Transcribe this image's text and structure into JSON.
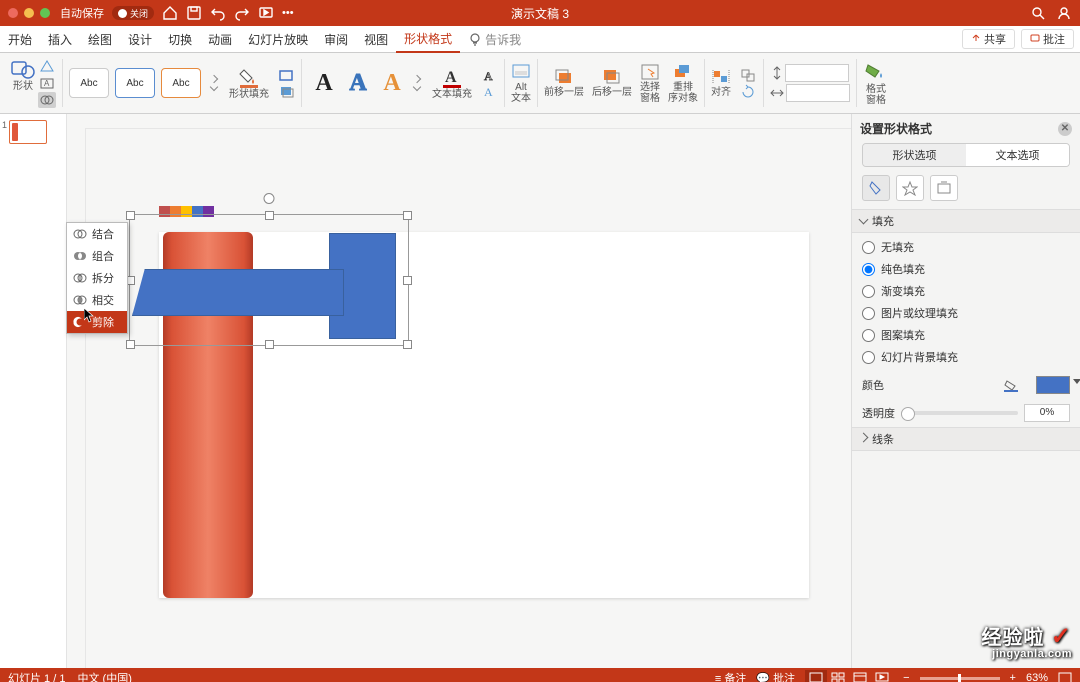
{
  "titlebar": {
    "traffic": [
      "#ed6a5e",
      "#f5bf4f",
      "#61c554"
    ],
    "autosave_label": "自动保存",
    "autosave_state": "关闭",
    "title": "演示文稿 3"
  },
  "menubar": {
    "tabs": [
      "开始",
      "插入",
      "绘图",
      "设计",
      "切换",
      "动画",
      "幻灯片放映",
      "审阅",
      "视图",
      "形状格式"
    ],
    "active": 9,
    "tellme": "告诉我",
    "share": "共享",
    "comments": "批注"
  },
  "ribbon": {
    "shape_lbl": "形状",
    "abc_cards": [
      "Abc",
      "Abc",
      "Abc"
    ],
    "shape_fill_lbl": "形状填充",
    "text_fill_lbl": "文本填充",
    "alt_lbl": "Alt\n文本",
    "bring_fwd": "前移一层",
    "send_back": "后移一层",
    "sel_pane": "选择\n窗格",
    "arrange": "重排\n序对象",
    "align_lbl": "对齐",
    "size_w": "",
    "size_h": "",
    "fmt_pane_lbl": "格式\n窗格"
  },
  "merge_menu": {
    "items": [
      "结合",
      "组合",
      "拆分",
      "相交",
      "剪除"
    ],
    "hover": 4
  },
  "thumbs": {
    "n1": "1"
  },
  "slide_colors": [
    "#c0504d",
    "#ed7d31",
    "#a5a5a5",
    "#ffc000",
    "#5b9bd5",
    "#7030a0"
  ],
  "fmt_pane": {
    "title": "设置形状格式",
    "tab_shape": "形状选项",
    "tab_text": "文本选项",
    "sect_fill": "填充",
    "fills": [
      "无填充",
      "纯色填充",
      "渐变填充",
      "图片或纹理填充",
      "图案填充",
      "幻灯片背景填充"
    ],
    "fill_sel": 1,
    "color_lbl": "颜色",
    "opacity_lbl": "透明度",
    "opacity_val": "0%",
    "sect_line": "线条"
  },
  "status": {
    "slide": "幻灯片 1 / 1",
    "lang": "中文 (中国)",
    "notes": "备注",
    "cmts": "批注",
    "zoom": "63%"
  },
  "watermark": {
    "l1": "经验啦",
    "l2": "jingyanla.com"
  }
}
